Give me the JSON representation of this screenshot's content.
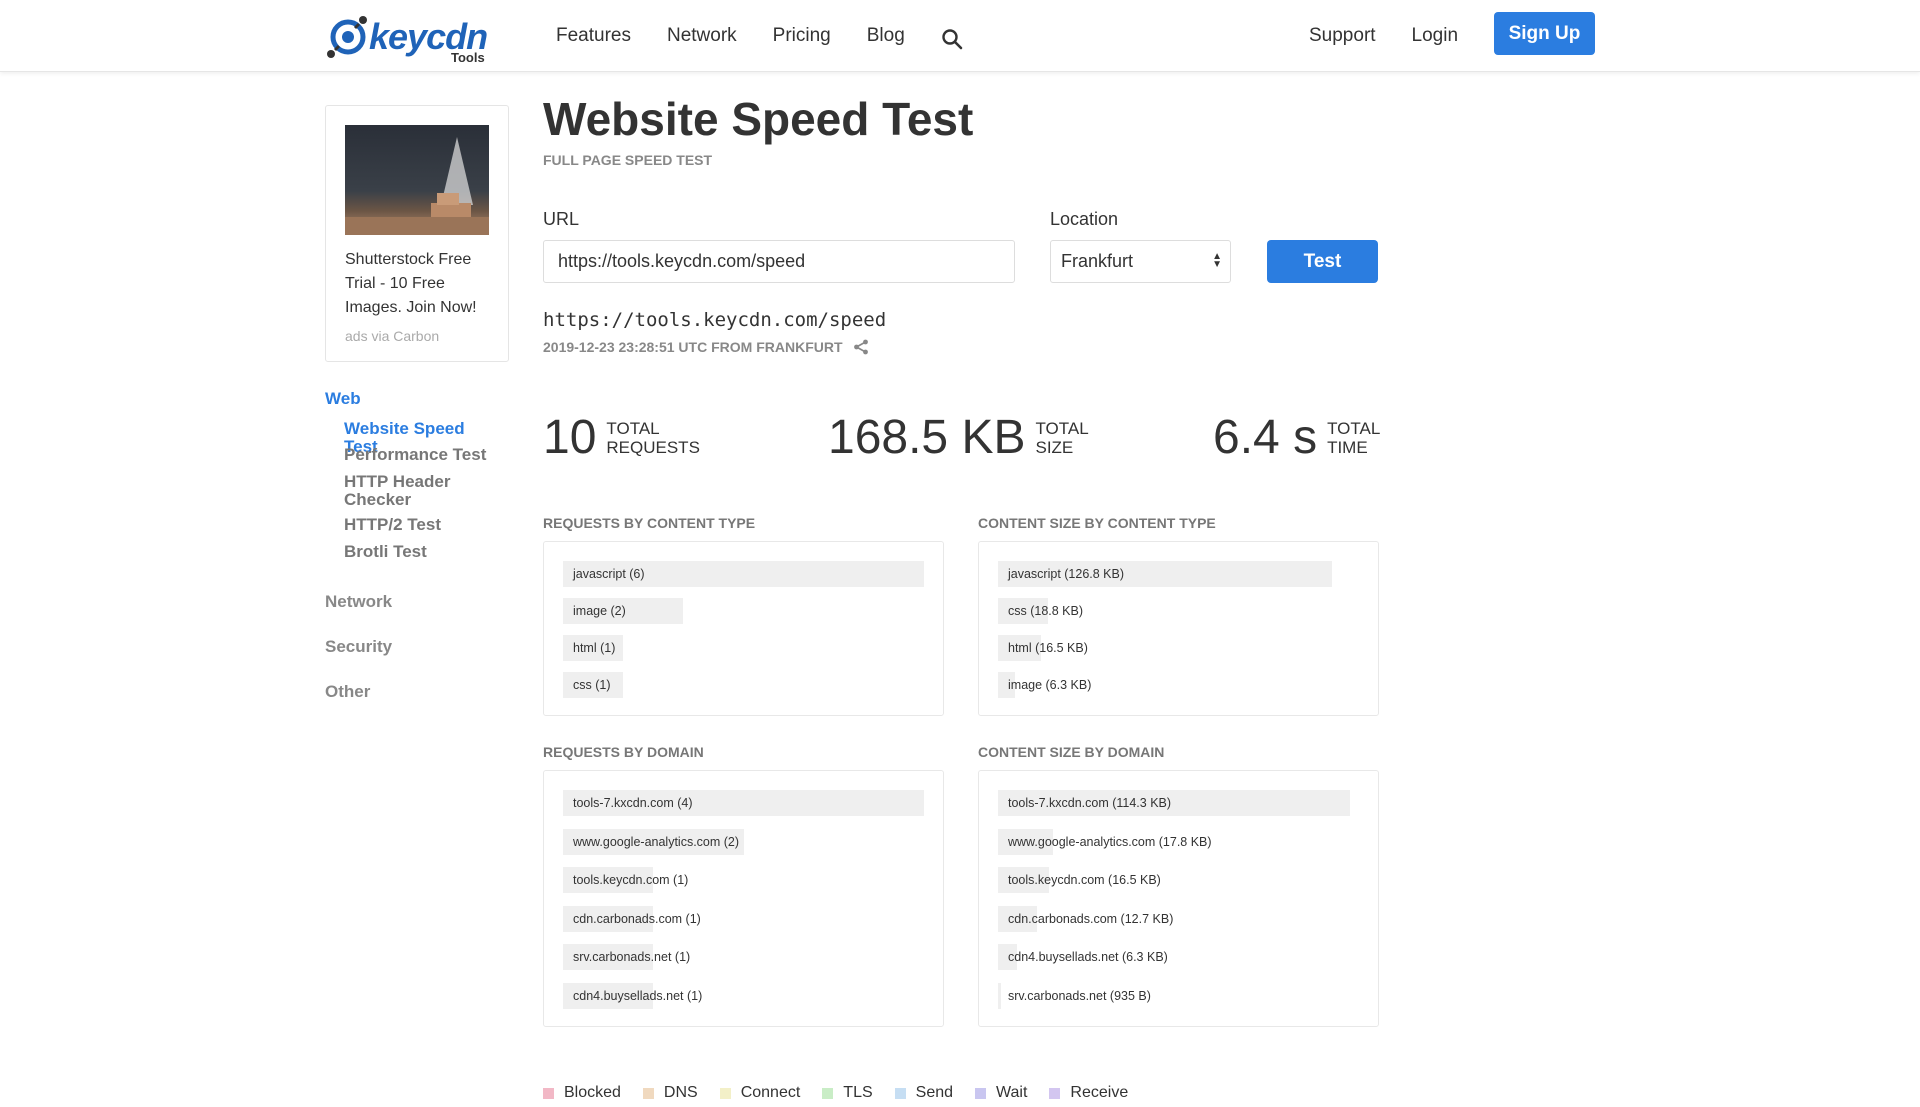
{
  "header": {
    "logo_text": "keycdn",
    "logo_sub": "Tools",
    "nav_left": [
      "Features",
      "Network",
      "Pricing",
      "Blog"
    ],
    "nav_right": [
      "Support",
      "Login"
    ],
    "signup_label": "Sign Up"
  },
  "ad": {
    "text": "Shutterstock Free Trial - 10 Free Images. Join Now!",
    "via": "ads via Carbon"
  },
  "sidebar": {
    "web_label": "Web",
    "web_items": [
      "Website Speed Test",
      "Performance Test",
      "HTTP Header Checker",
      "HTTP/2 Test",
      "Brotli Test"
    ],
    "categories": [
      "Network",
      "Security",
      "Other"
    ]
  },
  "main": {
    "title": "Website Speed Test",
    "subtitle": "FULL PAGE SPEED TEST",
    "url_label": "URL",
    "url_value": "https://tools.keycdn.com/speed",
    "location_label": "Location",
    "location_value": "Frankfurt",
    "test_label": "Test",
    "result_url": "https://tools.keycdn.com/speed",
    "result_meta": "2019-12-23 23:28:51 UTC FROM FRANKFURT"
  },
  "stats": {
    "requests_num": "10",
    "requests_label_1": "TOTAL",
    "requests_label_2": "REQUESTS",
    "size_num": "168.5 KB",
    "size_label_1": "TOTAL",
    "size_label_2": "SIZE",
    "time_num": "6.4 s",
    "time_label_1": "TOTAL",
    "time_label_2": "TIME"
  },
  "sections": {
    "req_type_title": "REQUESTS BY CONTENT TYPE",
    "size_type_title": "CONTENT SIZE BY CONTENT TYPE",
    "req_domain_title": "REQUESTS BY DOMAIN",
    "size_domain_title": "CONTENT SIZE BY DOMAIN"
  },
  "req_type": [
    {
      "label": "javascript (6)",
      "value": 6
    },
    {
      "label": "image (2)",
      "value": 2
    },
    {
      "label": "html (1)",
      "value": 1
    },
    {
      "label": "css (1)",
      "value": 1
    }
  ],
  "size_type": [
    {
      "label": "javascript (126.8 KB)",
      "value": 126.8
    },
    {
      "label": "css (18.8 KB)",
      "value": 18.8
    },
    {
      "label": "html (16.5 KB)",
      "value": 16.5
    },
    {
      "label": "image (6.3 KB)",
      "value": 6.3
    }
  ],
  "req_domain": [
    {
      "label": "tools-7.kxcdn.com (4)",
      "value": 4
    },
    {
      "label": "www.google-analytics.com (2)",
      "value": 2
    },
    {
      "label": "tools.keycdn.com (1)",
      "value": 1
    },
    {
      "label": "cdn.carbonads.com (1)",
      "value": 1
    },
    {
      "label": "srv.carbonads.net (1)",
      "value": 1
    },
    {
      "label": "cdn4.buysellads.net (1)",
      "value": 1
    }
  ],
  "size_domain": [
    {
      "label": "tools-7.kxcdn.com (114.3 KB)",
      "value": 114.3
    },
    {
      "label": "www.google-analytics.com (17.8 KB)",
      "value": 17.8
    },
    {
      "label": "tools.keycdn.com (16.5 KB)",
      "value": 16.5
    },
    {
      "label": "cdn.carbonads.com (12.7 KB)",
      "value": 12.7
    },
    {
      "label": "cdn4.buysellads.net (6.3 KB)",
      "value": 6.3
    },
    {
      "label": "srv.carbonads.net (935 B)",
      "value": 0.935
    }
  ],
  "legend": [
    {
      "label": "Blocked",
      "color": "#f2b8c6"
    },
    {
      "label": "DNS",
      "color": "#f0d9bf"
    },
    {
      "label": "Connect",
      "color": "#f3f0c8"
    },
    {
      "label": "TLS",
      "color": "#c9edc6"
    },
    {
      "label": "Send",
      "color": "#c6def3"
    },
    {
      "label": "Wait",
      "color": "#c9c6f0"
    },
    {
      "label": "Receive",
      "color": "#d3c6f0"
    }
  ],
  "colors": {
    "accent": "#2b7de0",
    "logo": "#1f63b8"
  }
}
